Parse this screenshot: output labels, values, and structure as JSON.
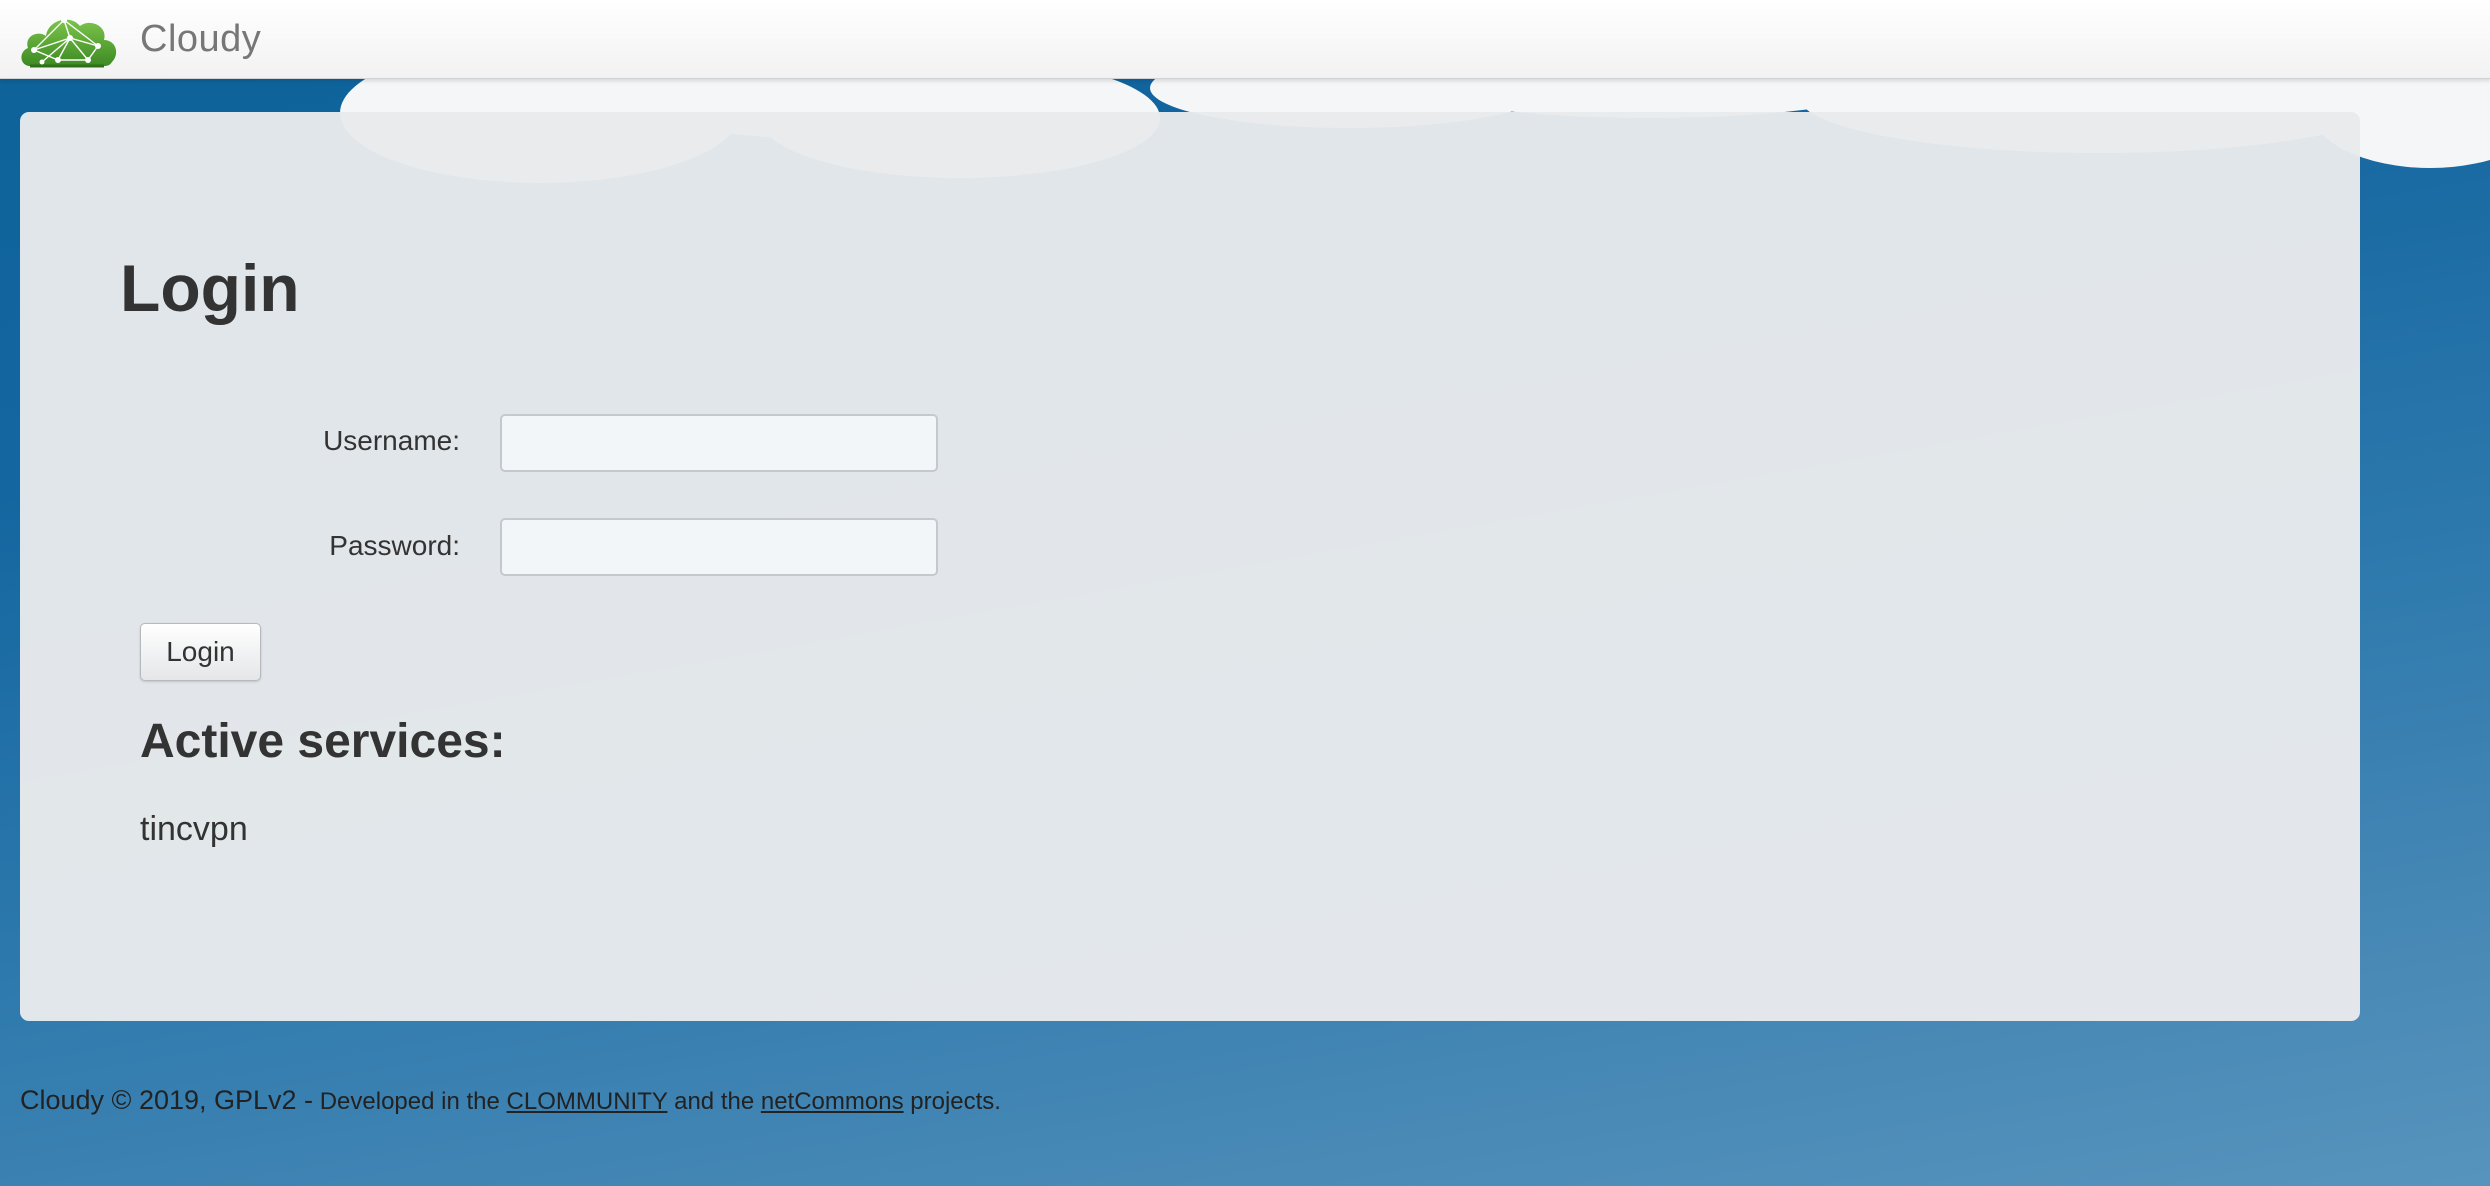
{
  "navbar": {
    "brand_name": "Cloudy",
    "logo_icon": "cloud-network-logo-icon"
  },
  "login": {
    "title": "Login",
    "username_label": "Username:",
    "username_value": "",
    "password_label": "Password:",
    "password_value": "",
    "submit_label": "Login"
  },
  "services": {
    "title": "Active services:",
    "items": [
      "tincvpn"
    ]
  },
  "footer": {
    "copyright": "Cloudy © 2019, GPLv2 -",
    "developed_text": "Developed in the",
    "link1": "CLOMMUNITY",
    "and_text": "and the",
    "link2": "netCommons",
    "projects_text": "projects."
  },
  "colors": {
    "background_top": "#0d6299",
    "background_bottom": "#5794bd",
    "panel": "#e8eaec",
    "logo_green": "#5aa632",
    "text": "#333333"
  }
}
